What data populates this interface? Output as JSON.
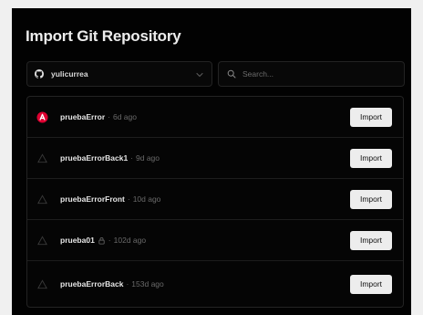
{
  "header": {
    "title": "Import Git Repository"
  },
  "account": {
    "name": "yulicurrea",
    "icon": "github-icon"
  },
  "search": {
    "placeholder": "Search..."
  },
  "repos": [
    {
      "name": "pruebaError",
      "separator": "·",
      "age": "6d ago",
      "icon": "angular-icon",
      "private": false,
      "import_label": "Import"
    },
    {
      "name": "pruebaErrorBack1",
      "separator": "·",
      "age": "9d ago",
      "icon": "vercel-icon",
      "private": false,
      "import_label": "Import"
    },
    {
      "name": "pruebaErrorFront",
      "separator": "·",
      "age": "10d ago",
      "icon": "vercel-icon",
      "private": false,
      "import_label": "Import"
    },
    {
      "name": "prueba01",
      "separator": "·",
      "age": "102d ago",
      "icon": "vercel-icon",
      "private": true,
      "import_label": "Import"
    },
    {
      "name": "pruebaErrorBack",
      "separator": "·",
      "age": "153d ago",
      "icon": "vercel-icon",
      "private": false,
      "import_label": "Import"
    }
  ],
  "colors": {
    "background": "#020202",
    "border": "#232323",
    "angular": "#dd0031",
    "button_bg": "#ededed",
    "muted_text": "#6a6a6a"
  }
}
